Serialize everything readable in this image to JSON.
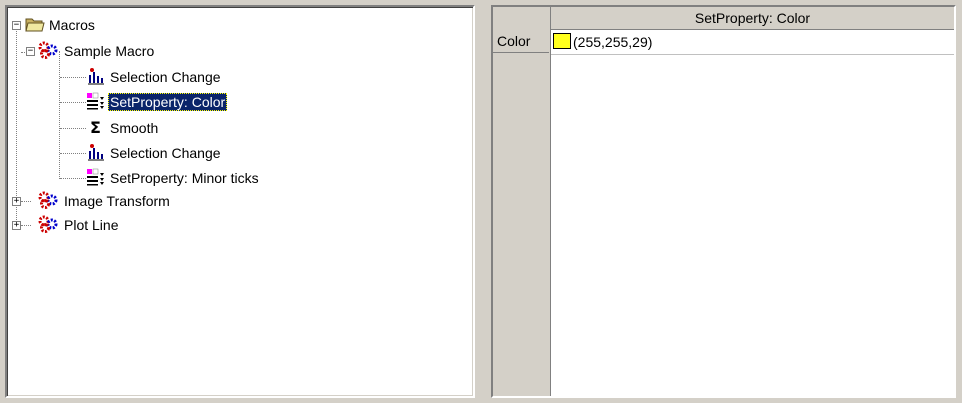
{
  "tree": {
    "root": {
      "label": "Macros",
      "icon": "folder-open-icon",
      "expanded": true
    },
    "macros": [
      {
        "label": "Sample Macro",
        "icon": "macro-gear-icon",
        "expanded": true,
        "steps": [
          {
            "label": "Selection Change",
            "icon": "selection-change-icon"
          },
          {
            "label": "SetProperty: Color",
            "icon": "set-property-icon",
            "selected": true
          },
          {
            "label": "Smooth",
            "icon": "sigma-icon"
          },
          {
            "label": "Selection Change",
            "icon": "selection-change-icon"
          },
          {
            "label": "SetProperty: Minor ticks",
            "icon": "set-property-icon"
          }
        ]
      },
      {
        "label": "Image Transform",
        "icon": "macro-gear-icon",
        "expanded": false
      },
      {
        "label": "Plot Line",
        "icon": "macro-gear-icon",
        "expanded": false
      }
    ]
  },
  "property_grid": {
    "column_header": "SetProperty: Color",
    "rows": [
      {
        "name": "Color",
        "value": "(255,255,29)",
        "swatch_color": "#ffff1d"
      }
    ]
  },
  "colors": {
    "selection_bg": "#0a246a",
    "panel_bg": "#d4d0c8"
  }
}
